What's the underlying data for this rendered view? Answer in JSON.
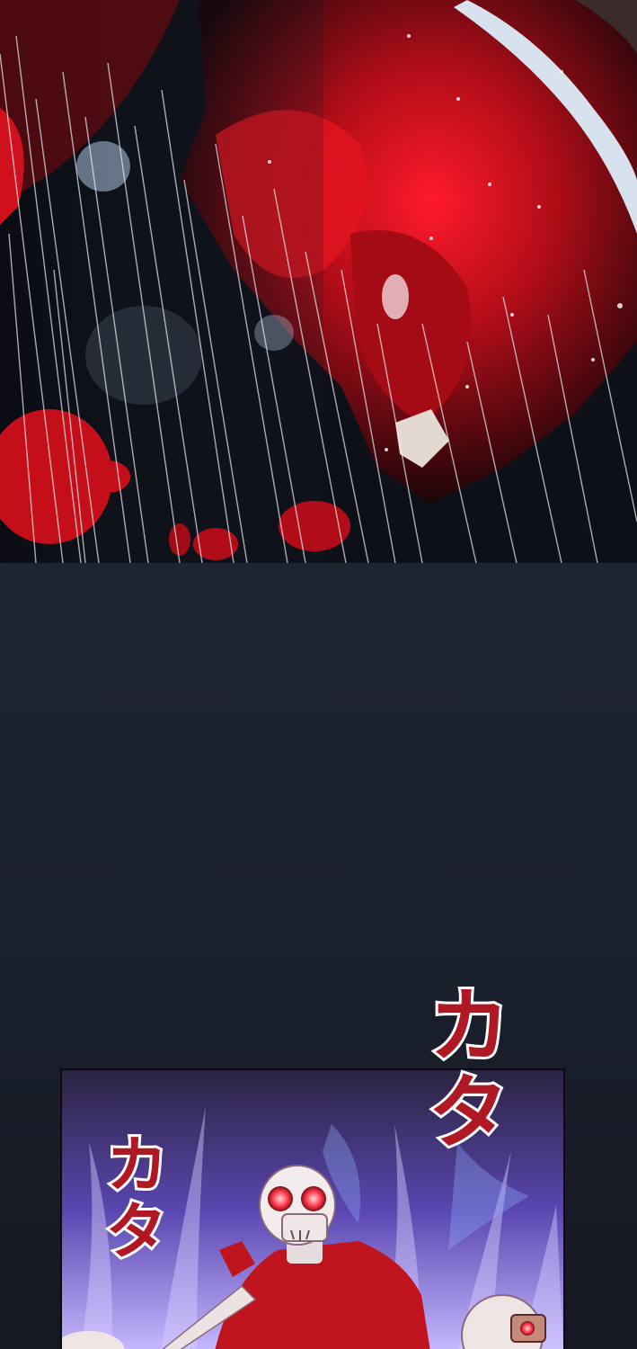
{
  "colors": {
    "blood_red": "#c8101c",
    "dark_red": "#5a0a12",
    "gutter": "#1c2230",
    "aura_purple": "#7a5cff",
    "sfx_red": "#b01824",
    "skull_eye": "#ff3a4a"
  },
  "panels": {
    "top": {
      "description_icon": "blood-rain-scene"
    },
    "bottom": {
      "description_icon": "skeleton-summon-scene"
    }
  },
  "sfx": {
    "large": "カタ",
    "small": "カタ"
  }
}
